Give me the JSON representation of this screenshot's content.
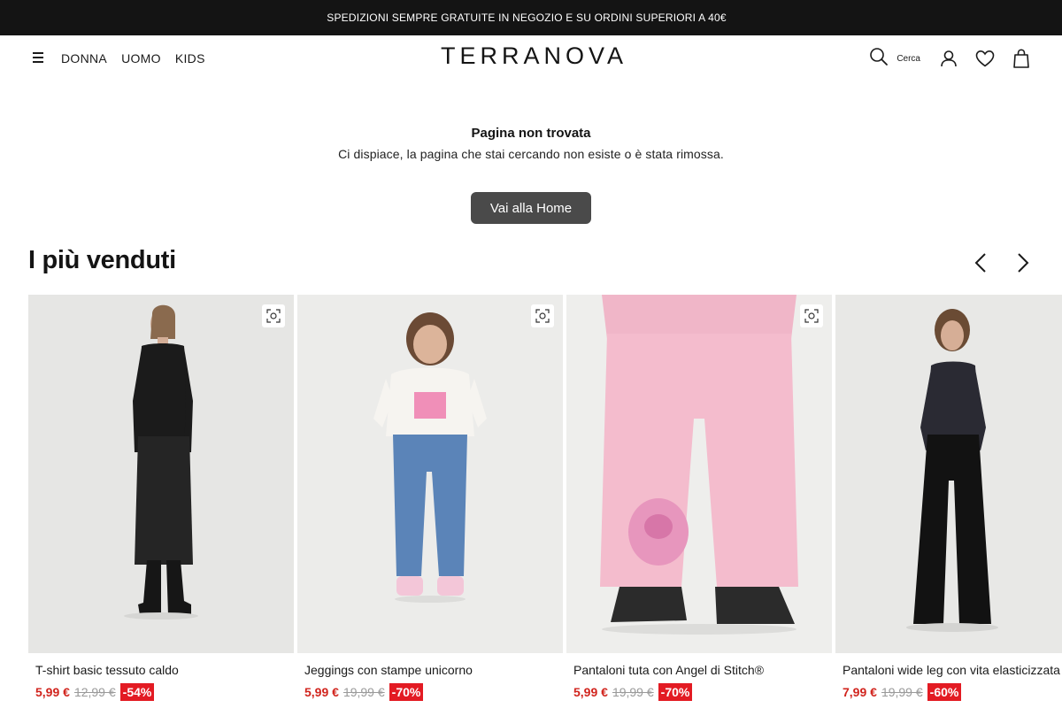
{
  "promo": {
    "text": "SPEDIZIONI SEMPRE GRATUITE  IN NEGOZIO E SU ORDINI SUPERIORI A 40€"
  },
  "header": {
    "menu_icon": "hamburger-menu-icon",
    "nav": [
      "DONNA",
      "UOMO",
      "KIDS"
    ],
    "logo": "TERRANOVA",
    "search_label": "Cerca",
    "icons": [
      "search-icon",
      "user-icon",
      "heart-icon",
      "shopping-bag-icon"
    ]
  },
  "not_found": {
    "title": "Pagina non trovata",
    "message": "Ci dispiace, la pagina che stai cercando non esiste o è stata rimossa.",
    "button": "Vai alla Home"
  },
  "bestsellers": {
    "title": "I più venduti",
    "prev_icon": "chevron-left-icon",
    "next_icon": "chevron-right-icon",
    "products": [
      {
        "name": "T-shirt basic tessuto caldo",
        "price": "5,99 €",
        "old_price": "12,99 €",
        "discount": "-54%",
        "image": "woman-black-outfit-photo"
      },
      {
        "name": "Jeggings con stampe unicorno",
        "price": "5,99 €",
        "old_price": "19,99 €",
        "discount": "-70%",
        "image": "girl-unicorn-jeggings-photo"
      },
      {
        "name": "Pantaloni tuta con Angel di Stitch®",
        "price": "5,99 €",
        "old_price": "19,99 €",
        "discount": "-70%",
        "image": "pink-stitch-sweatpants-photo"
      },
      {
        "name": "Pantaloni wide leg con vita elasticizzata",
        "price": "7,99 €",
        "old_price": "19,99 €",
        "discount": "-60%",
        "image": "woman-wide-leg-pants-photo"
      }
    ]
  },
  "colors": {
    "promo_bg": "#141414",
    "button_bg": "#4a4a4a",
    "sale_price": "#d1241d",
    "discount_bg": "#e31b23"
  }
}
